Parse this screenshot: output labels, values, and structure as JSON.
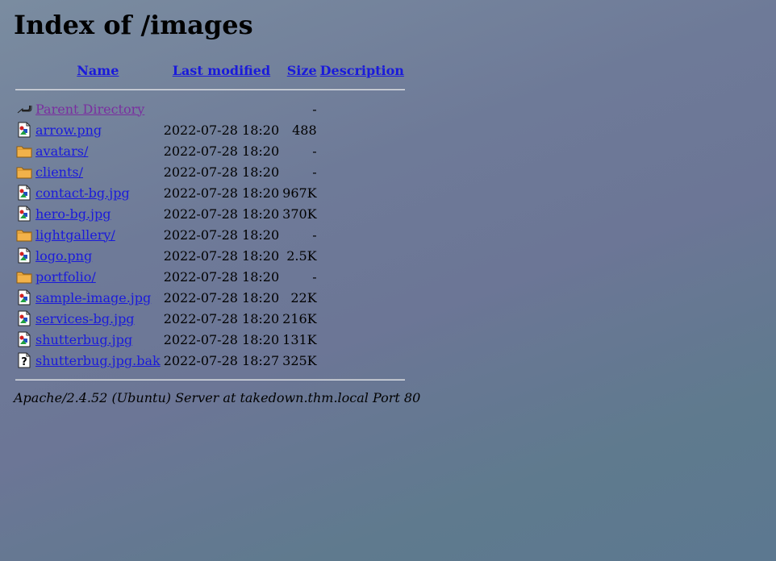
{
  "title": "Index of /images",
  "columns": {
    "name": "Name",
    "last_modified": "Last modified",
    "size": "Size",
    "description": "Description"
  },
  "rows": [
    {
      "icon": "back-icon",
      "name": "Parent Directory",
      "modified": "",
      "size": "-",
      "visited": true
    },
    {
      "icon": "image-icon",
      "name": "arrow.png",
      "modified": "2022-07-28 18:20",
      "size": "488"
    },
    {
      "icon": "folder-icon",
      "name": "avatars/",
      "modified": "2022-07-28 18:20",
      "size": "-"
    },
    {
      "icon": "folder-icon",
      "name": "clients/",
      "modified": "2022-07-28 18:20",
      "size": "-"
    },
    {
      "icon": "image-icon",
      "name": "contact-bg.jpg",
      "modified": "2022-07-28 18:20",
      "size": "967K"
    },
    {
      "icon": "image-icon",
      "name": "hero-bg.jpg",
      "modified": "2022-07-28 18:20",
      "size": "370K"
    },
    {
      "icon": "folder-icon",
      "name": "lightgallery/",
      "modified": "2022-07-28 18:20",
      "size": "-"
    },
    {
      "icon": "image-icon",
      "name": "logo.png",
      "modified": "2022-07-28 18:20",
      "size": "2.5K"
    },
    {
      "icon": "folder-icon",
      "name": "portfolio/",
      "modified": "2022-07-28 18:20",
      "size": "-"
    },
    {
      "icon": "image-icon",
      "name": "sample-image.jpg",
      "modified": "2022-07-28 18:20",
      "size": "22K"
    },
    {
      "icon": "image-icon",
      "name": "services-bg.jpg",
      "modified": "2022-07-28 18:20",
      "size": "216K"
    },
    {
      "icon": "image-icon",
      "name": "shutterbug.jpg",
      "modified": "2022-07-28 18:20",
      "size": "131K"
    },
    {
      "icon": "unknown-icon",
      "name": "shutterbug.jpg.bak",
      "modified": "2022-07-28 18:27",
      "size": "325K"
    }
  ],
  "footer": "Apache/2.4.52 (Ubuntu) Server at takedown.thm.local Port 80",
  "colors": {
    "link": "#1a1adb",
    "visited_link": "#7a2fa0"
  }
}
